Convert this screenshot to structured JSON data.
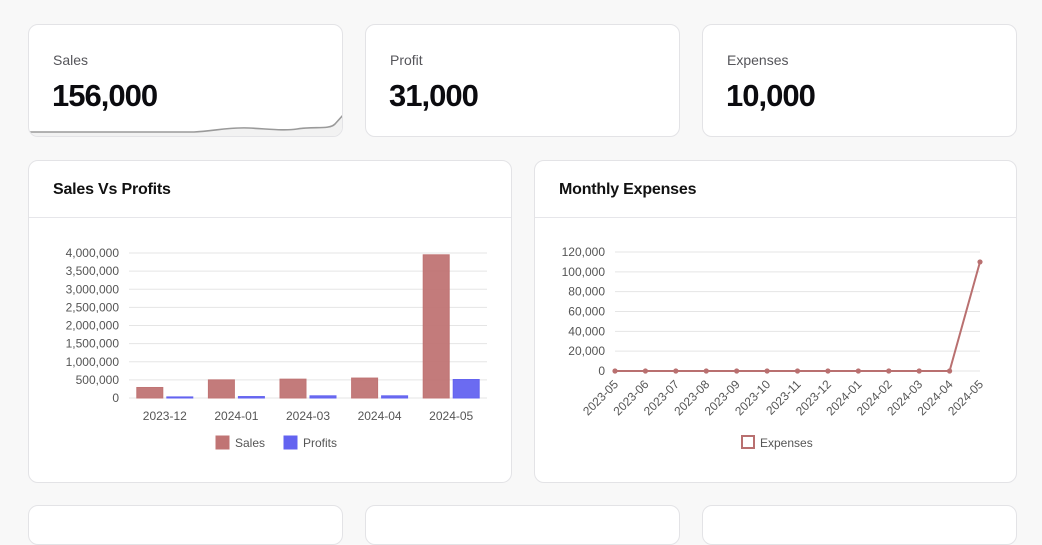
{
  "stats": [
    {
      "label": "Sales",
      "value": "156,000"
    },
    {
      "label": "Profit",
      "value": "31,000"
    },
    {
      "label": "Expenses",
      "value": "10,000"
    }
  ],
  "sales_vs_profits": {
    "title": "Sales Vs Profits"
  },
  "monthly_expenses": {
    "title": "Monthly Expenses"
  },
  "chart_data": [
    {
      "type": "bar",
      "title": "Sales Vs Profits",
      "categories": [
        "2023-12",
        "2024-01",
        "2024-03",
        "2024-04",
        "2024-05"
      ],
      "series": [
        {
          "name": "Sales",
          "values": [
            290000,
            500000,
            520000,
            550000,
            3950000
          ],
          "color": "#c07474"
        },
        {
          "name": "Profits",
          "values": [
            30000,
            40000,
            60000,
            60000,
            510000
          ],
          "color": "#6363f0"
        }
      ],
      "ylim": [
        0,
        4000000
      ],
      "yticks": [
        "0",
        "500,000",
        "1,000,000",
        "1,500,000",
        "2,000,000",
        "2,500,000",
        "3,000,000",
        "3,500,000",
        "4,000,000"
      ],
      "legend": "bottom",
      "grid": true
    },
    {
      "type": "line",
      "title": "Monthly Expenses",
      "categories": [
        "2023-05",
        "2023-06",
        "2023-07",
        "2023-08",
        "2023-09",
        "2023-10",
        "2023-11",
        "2023-12",
        "2024-01",
        "2024-02",
        "2024-03",
        "2024-04",
        "2024-05"
      ],
      "series": [
        {
          "name": "Expenses",
          "values": [
            0,
            0,
            0,
            0,
            0,
            0,
            0,
            0,
            0,
            0,
            0,
            0,
            110000
          ],
          "color": "#b97070"
        }
      ],
      "ylim": [
        0,
        120000
      ],
      "yticks": [
        "0",
        "20,000",
        "40,000",
        "60,000",
        "80,000",
        "100,000",
        "120,000"
      ],
      "legend": "bottom",
      "grid": true
    }
  ]
}
